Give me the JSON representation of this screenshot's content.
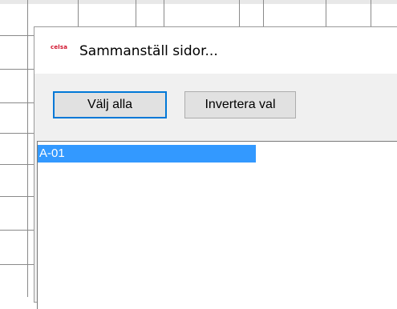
{
  "dialog": {
    "app_logo_text": "celsa",
    "title": "Sammanställ sidor...",
    "buttons": {
      "select_all": "Välj alla",
      "invert_selection": "Invertera val"
    },
    "list": {
      "items": [
        {
          "label": "A-01",
          "selected": true
        }
      ]
    }
  },
  "colors": {
    "selection": "#3399ff",
    "default_button_border": "#0078d7",
    "logo": "#d0102a"
  }
}
